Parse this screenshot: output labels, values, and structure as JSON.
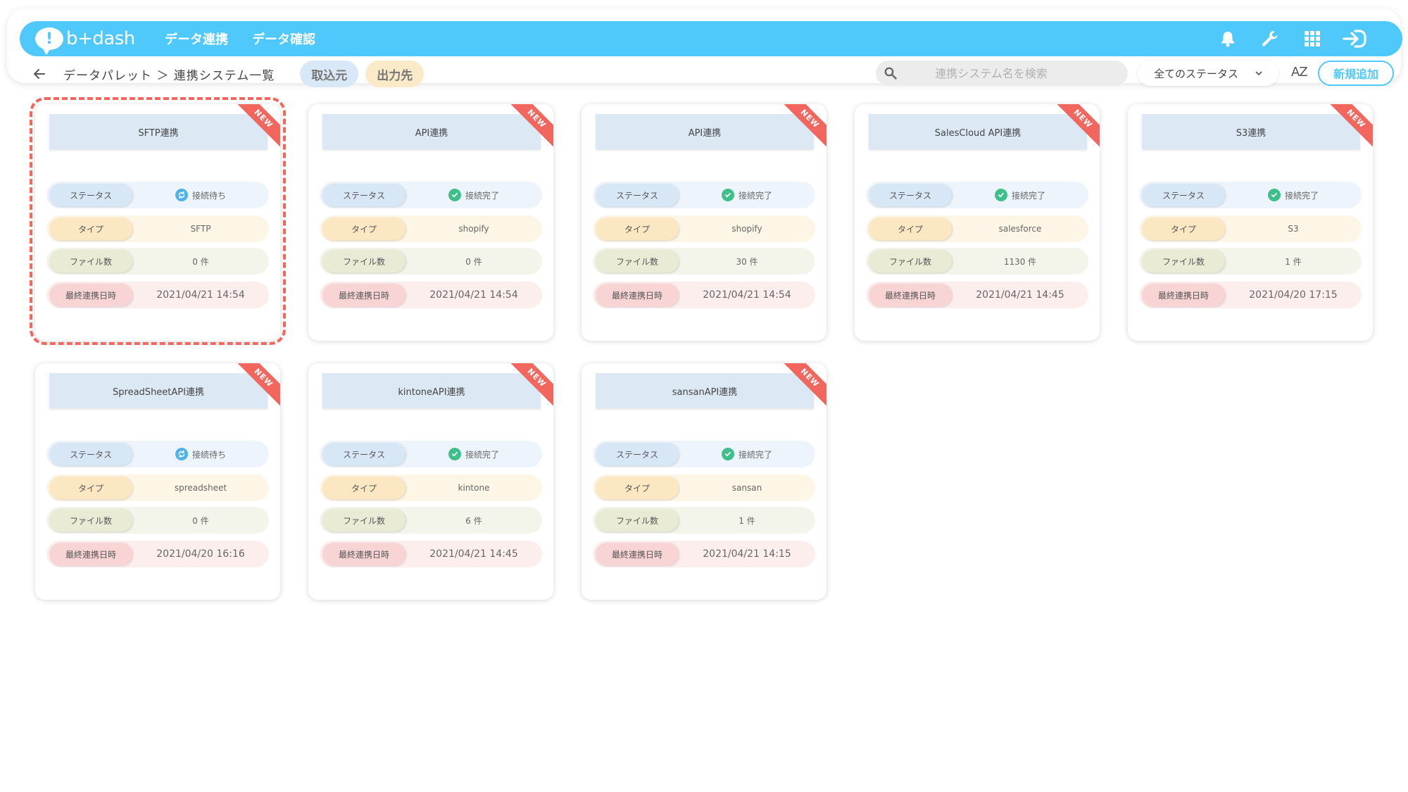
{
  "header": {
    "logo_text": "b+dash",
    "nav": [
      "データ連携",
      "データ確認"
    ],
    "icons": [
      "bell-icon",
      "wrench-icon",
      "grid-icon",
      "logout-icon"
    ],
    "accent_color": "#4fc8fb"
  },
  "subbar": {
    "breadcrumb": "データパレット ＞ 連携システム一覧",
    "tab_in": "取込元",
    "tab_out": "出力先",
    "search_placeholder": "連携システム名を検索",
    "status_filter": "全てのステータス",
    "sort_label": "AZ",
    "new_button": "新規追加"
  },
  "labels": {
    "status": "ステータス",
    "type": "タイプ",
    "files": "ファイル数",
    "last_sync": "最終連携日時",
    "new_badge": "NEW"
  },
  "cards": [
    {
      "title": "SFTP連携",
      "status": "接続待ち",
      "status_kind": "wait",
      "type": "SFTP",
      "files": "0 件",
      "last_sync": "2021/04/21 14:54"
    },
    {
      "title": "API連携",
      "status": "接続完了",
      "status_kind": "done",
      "type": "shopify",
      "files": "0 件",
      "last_sync": "2021/04/21 14:54"
    },
    {
      "title": "API連携",
      "status": "接続完了",
      "status_kind": "done",
      "type": "shopify",
      "files": "30 件",
      "last_sync": "2021/04/21 14:54"
    },
    {
      "title": "SalesCloud API連携",
      "status": "接続完了",
      "status_kind": "done",
      "type": "salesforce",
      "files": "1130 件",
      "last_sync": "2021/04/21 14:45"
    },
    {
      "title": "S3連携",
      "status": "接続完了",
      "status_kind": "done",
      "type": "S3",
      "files": "1 件",
      "last_sync": "2021/04/20 17:15"
    },
    {
      "title": "SpreadSheetAPI連携",
      "status": "接続待ち",
      "status_kind": "wait",
      "type": "spreadsheet",
      "files": "0 件",
      "last_sync": "2021/04/20 16:16"
    },
    {
      "title": "kintoneAPI連携",
      "status": "接続完了",
      "status_kind": "done",
      "type": "kintone",
      "files": "6 件",
      "last_sync": "2021/04/21 14:45"
    },
    {
      "title": "sansanAPI連携",
      "status": "接続完了",
      "status_kind": "done",
      "type": "sansan",
      "files": "1 件",
      "last_sync": "2021/04/21 14:15"
    }
  ]
}
